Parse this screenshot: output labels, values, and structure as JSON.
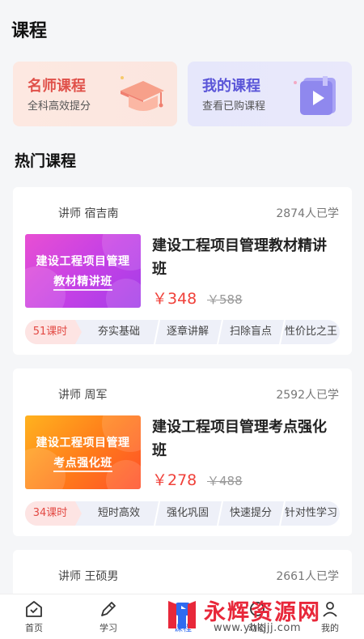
{
  "page": {
    "title": "课程"
  },
  "banners": [
    {
      "title": "名师课程",
      "subtitle": "全科高效提分",
      "icon": "graduation-cap-icon"
    },
    {
      "title": "我的课程",
      "subtitle": "查看已购课程",
      "icon": "video-book-icon"
    }
  ],
  "section": {
    "title": "热门课程"
  },
  "courses": [
    {
      "teacher": "讲师  宿吉南",
      "learners": "2874人已学",
      "thumb_line1": "建设工程项目管理",
      "thumb_line2": "教材精讲班",
      "title": "建设工程项目管理教材精讲班",
      "price": "￥348",
      "original_price": "￥588",
      "hours": "51课时",
      "tags": [
        "夯实基础",
        "逐章讲解",
        "扫除盲点",
        "性价比之王"
      ]
    },
    {
      "teacher": "讲师  周军",
      "learners": "2592人已学",
      "thumb_line1": "建设工程项目管理",
      "thumb_line2": "考点强化班",
      "title": "建设工程项目管理考点强化班",
      "price": "￥278",
      "original_price": "￥488",
      "hours": "34课时",
      "tags": [
        "短时高效",
        "强化巩固",
        "快速提分",
        "针对性学习"
      ]
    },
    {
      "teacher": "讲师  王硕男",
      "learners": "2661人已学"
    }
  ],
  "nav": [
    {
      "label": "首页",
      "icon": "home-icon"
    },
    {
      "label": "学习",
      "icon": "pencil-icon"
    },
    {
      "label": "课程",
      "icon": "course-icon"
    },
    {
      "label": "动态",
      "icon": "feed-icon"
    },
    {
      "label": "我的",
      "icon": "profile-icon"
    }
  ],
  "watermark": {
    "text": "永辉资源网",
    "url": "www.yhkjjj.com"
  },
  "colors": {
    "accent": "#2f6bf0",
    "price": "#f0413a",
    "banner_red": "#e0514a",
    "banner_purple": "#5a55d8"
  }
}
